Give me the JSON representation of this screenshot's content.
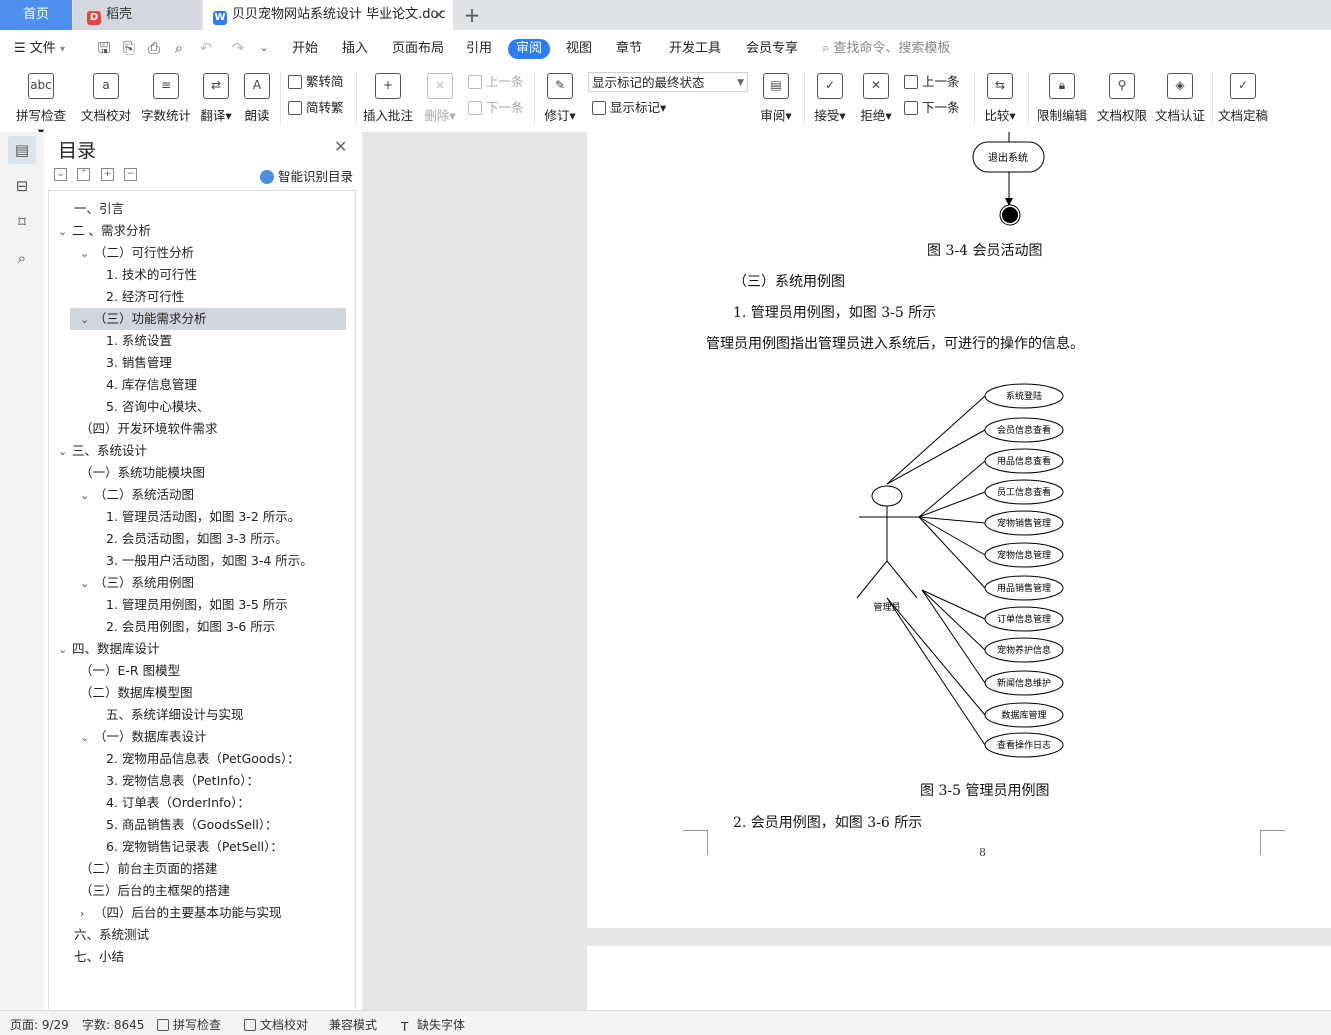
{
  "tabs": {
    "home": "首页",
    "daoke": "稻壳",
    "doc": "贝贝宠物网站系统设计 毕业论文.doc",
    "add_glyph": "+",
    "close_glyph": "×"
  },
  "menubar": {
    "file": "文件",
    "items": [
      "开始",
      "插入",
      "页面布局",
      "引用",
      "审阅",
      "视图",
      "章节",
      "开发工具",
      "会员专享"
    ],
    "search_placeholder": "查找命令、搜索模板"
  },
  "ribbon": {
    "spell": "拼写检查",
    "proof": "文档校对",
    "wordcount": "字数统计",
    "translate": "翻译",
    "read": "朗读",
    "to_trad": "繁转简",
    "to_simp": "简转繁",
    "insert_comment": "插入批注",
    "delete": "删除",
    "prev": "上一条",
    "next": "下一条",
    "revise": "修订",
    "markup_state": "显示标记的最终状态",
    "show_markup": "显示标记",
    "review": "审阅",
    "accept": "接受",
    "reject": "拒绝",
    "prev2": "上一条",
    "next2": "下一条",
    "compare": "比较",
    "restrict": "限制编辑",
    "permission": "文档权限",
    "certify": "文档认证",
    "finalize": "文档定稿"
  },
  "toc": {
    "title": "目录",
    "smart": "智能识别目录",
    "items": [
      {
        "text": "一、引言",
        "caret": ""
      },
      {
        "text": "二 、需求分析",
        "caret": "v"
      },
      {
        "text": "（二）可行性分析",
        "caret": "v"
      },
      {
        "text": "1. 技术的可行性",
        "caret": ""
      },
      {
        "text": "2.   经济可行性",
        "caret": ""
      },
      {
        "text": "（三）功能需求分析",
        "caret": "v"
      },
      {
        "text": "1. 系统设置",
        "caret": ""
      },
      {
        "text": "3. 销售管理",
        "caret": ""
      },
      {
        "text": "4. 库存信息管理",
        "caret": ""
      },
      {
        "text": "5. 咨询中心模块、",
        "caret": ""
      },
      {
        "text": "（四）开发环境软件需求",
        "caret": ""
      },
      {
        "text": "三、系统设计",
        "caret": "v"
      },
      {
        "text": "（一）系统功能模块图",
        "caret": ""
      },
      {
        "text": "（二）系统活动图",
        "caret": "v"
      },
      {
        "text": "1. 管理员活动图，如图 3-2 所示。",
        "caret": ""
      },
      {
        "text": "2. 会员活动图，如图 3-3 所示。",
        "caret": ""
      },
      {
        "text": "3. 一般用户活动图，如图 3-4 所示。",
        "caret": ""
      },
      {
        "text": "（三）系统用例图",
        "caret": "v"
      },
      {
        "text": "1. 管理员用例图，如图 3-5 所示",
        "caret": ""
      },
      {
        "text": "2. 会员用例图，如图 3-6 所示",
        "caret": ""
      },
      {
        "text": "四、数据库设计",
        "caret": "v"
      },
      {
        "text": "（一）E-R 图模型",
        "caret": ""
      },
      {
        "text": "（二）数据库模型图",
        "caret": ""
      },
      {
        "text": "五、系统详细设计与实现",
        "caret": ""
      },
      {
        "text": "（一）数据库表设计",
        "caret": "v"
      },
      {
        "text": "2. 宠物用品信息表（PetGoods）：",
        "caret": ""
      },
      {
        "text": "3. 宠物信息表（PetInfo）：",
        "caret": ""
      },
      {
        "text": "4. 订单表（OrderInfo）：",
        "caret": ""
      },
      {
        "text": "5. 商品销售表（GoodsSell）：",
        "caret": ""
      },
      {
        "text": "6. 宠物销售记录表（PetSell）：",
        "caret": ""
      },
      {
        "text": "（二）前台主页面的搭建",
        "caret": ""
      },
      {
        "text": "（三）后台的主框架的搭建",
        "caret": ""
      },
      {
        "text": "（四）后台的主要基本功能与实现",
        "caret": ">"
      },
      {
        "text": "六、系统测试",
        "caret": ""
      },
      {
        "text": "七、小结",
        "caret": ""
      }
    ]
  },
  "document": {
    "exit_node": "退出系统",
    "fig34": "图 3-4 会员活动图",
    "section": "（三）系统用例图",
    "item1": "1. 管理员用例图，如图 3-5 所示",
    "para": "管理员用例图指出管理员进入系统后，可进行的操作的信息。",
    "actor": "管理员",
    "usecases": [
      "系统登陆",
      "会员信息查看",
      "用品信息查看",
      "员工信息查看",
      "宠物销售管理",
      "宠物信息管理",
      "用品销售管理",
      "订单信息管理",
      "宠物养护信息",
      "新闻信息维护",
      "数据库管理",
      "查看操作日志"
    ],
    "fig35": "图 3-5 管理员用例图",
    "item2": "2. 会员用例图，如图 3-6 所示",
    "page_number": "8"
  },
  "status": {
    "page": "页面: 9/29",
    "words": "字数: 8645",
    "spell": "拼写检查",
    "proof": "文档校对",
    "compat": "兼容模式",
    "missing_font": "缺失字体"
  },
  "colors": {
    "accent": "#2e7cf6",
    "home_tab": "#4f8ff0",
    "toc_selected": "#cfd6de"
  }
}
